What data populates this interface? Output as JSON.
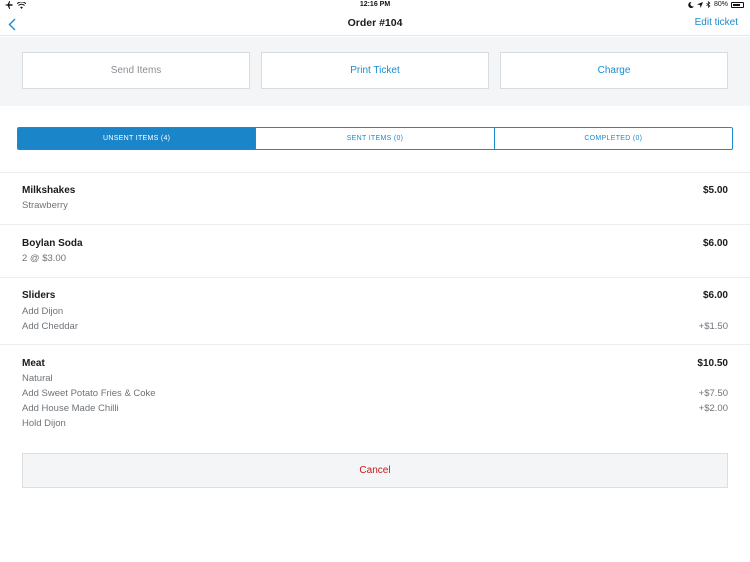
{
  "status_bar": {
    "time": "12:16 PM",
    "battery": "80%",
    "battery_level": 0.8
  },
  "nav": {
    "title": "Order #104",
    "edit_label": "Edit ticket"
  },
  "actions": {
    "send": "Send Items",
    "print": "Print Ticket",
    "charge": "Charge"
  },
  "tabs": [
    {
      "label": "UNSENT ITEMS (4)",
      "active": true
    },
    {
      "label": "SENT ITEMS (0)",
      "active": false
    },
    {
      "label": "COMPLETED (0)",
      "active": false
    }
  ],
  "items": [
    {
      "name": "Milkshakes",
      "price": "$5.00",
      "modifiers": [
        {
          "text": "Strawberry",
          "price": ""
        }
      ]
    },
    {
      "name": "Boylan Soda",
      "price": "$6.00",
      "modifiers": [
        {
          "text": "2 @ $3.00",
          "price": ""
        }
      ]
    },
    {
      "name": "Sliders",
      "price": "$6.00",
      "modifiers": [
        {
          "text": "Add Dijon",
          "price": ""
        },
        {
          "text": "Add Cheddar",
          "price": "+$1.50"
        }
      ]
    },
    {
      "name": "Meat",
      "price": "$10.50",
      "modifiers": [
        {
          "text": "Natural",
          "price": ""
        },
        {
          "text": "Add Sweet Potato Fries & Coke",
          "price": "+$7.50"
        },
        {
          "text": "Add House Made Chilli",
          "price": "+$2.00"
        },
        {
          "text": "Hold Dijon",
          "price": ""
        }
      ]
    }
  ],
  "cancel_label": "Cancel",
  "colors": {
    "accent": "#1a8ccf",
    "cancel": "#c21d1d"
  }
}
